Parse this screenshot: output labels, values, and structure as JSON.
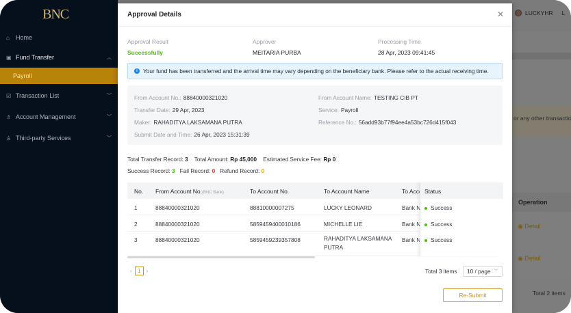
{
  "app": {
    "logo_text": "BNC",
    "accent_color": "#b88308"
  },
  "sidebar": {
    "items": [
      {
        "label": "Home",
        "icon": "home-icon"
      },
      {
        "label": "Fund Transfer",
        "icon": "transfer-icon",
        "expanded": true
      },
      {
        "label": "Payroll"
      },
      {
        "label": "Transaction List",
        "icon": "list-icon"
      },
      {
        "label": "Account Management",
        "icon": "account-icon"
      },
      {
        "label": "Third-party Services",
        "icon": "user-icon"
      }
    ]
  },
  "background": {
    "user": "LUCKYHR",
    "user_trail": "L",
    "notice_fragment": "or any other transactio",
    "operation_header": "Operation",
    "detail_link": "Detail",
    "total": "Total 2 items"
  },
  "modal": {
    "title": "Approval Details",
    "summary": {
      "result_label": "Approval Result",
      "result_value": "Successfully",
      "approver_label": "Approver",
      "approver_value": "MEITARIA PURBA",
      "time_label": "Processing Time",
      "time_value": "28 Apr, 2023 09:41:45"
    },
    "info_text": "Your fund has been transferred and the arrival time may vary depending on the beneficiary bank. Please refer to the actual receiving time.",
    "details": {
      "from_account_label": "From Account No.:",
      "from_account_value": "88840000321020",
      "from_name_label": "From Account Name:",
      "from_name_value": "TESTING CIB PT",
      "transfer_date_label": "Transfer Date:",
      "transfer_date_value": "29 Apr, 2023",
      "service_label": "Service:",
      "service_value": "Payroll",
      "maker_label": "Maker:",
      "maker_value": "RAHADITYA LAKSAMANA PUTRA",
      "reference_label": "Reference No.:",
      "reference_value": "56add93b77f94ee4a53bc726d415f043",
      "submit_label": "Submit Date and Time:",
      "submit_value": "26 Apr, 2023 15:31:39"
    },
    "totals": {
      "record_label": "Total Transfer Record:",
      "record_value": "3",
      "amount_label": "Total Amount:",
      "amount_value": "Rp 45,000",
      "fee_label": "Estimated Service Fee:",
      "fee_value": "Rp 0",
      "success_label": "Success Record:",
      "success_value": "3",
      "fail_label": "Fail Record:",
      "fail_value": "0",
      "refund_label": "Refund Record:",
      "refund_value": "0"
    },
    "table": {
      "headers": {
        "no": "No.",
        "from": "From Account No.",
        "from_sub": "(BNC Bank)",
        "to": "To Account No.",
        "to_name": "To Account Name",
        "to_bank": "To Acco",
        "status": "Status"
      },
      "rows": [
        {
          "no": "1",
          "from": "88840000321020",
          "to": "88810000007275",
          "to_name": "LUCKY LEONARD",
          "to_bank": "Bank Ne",
          "status": "Success"
        },
        {
          "no": "2",
          "from": "88840000321020",
          "to": "5859459400010186",
          "to_name": "MICHELLE LIE",
          "to_bank": "Bank Ne",
          "status": "Success"
        },
        {
          "no": "3",
          "from": "88840000321020",
          "to": "5859459239357808",
          "to_name": "RAHADITYA LAKSAMANA PUTRA",
          "to_bank": "Bank Ne",
          "status": "Success"
        }
      ]
    },
    "pagination": {
      "current": "1",
      "total": "Total 3 items",
      "page_size": "10 / page"
    },
    "resubmit_label": "Re-Submit"
  }
}
